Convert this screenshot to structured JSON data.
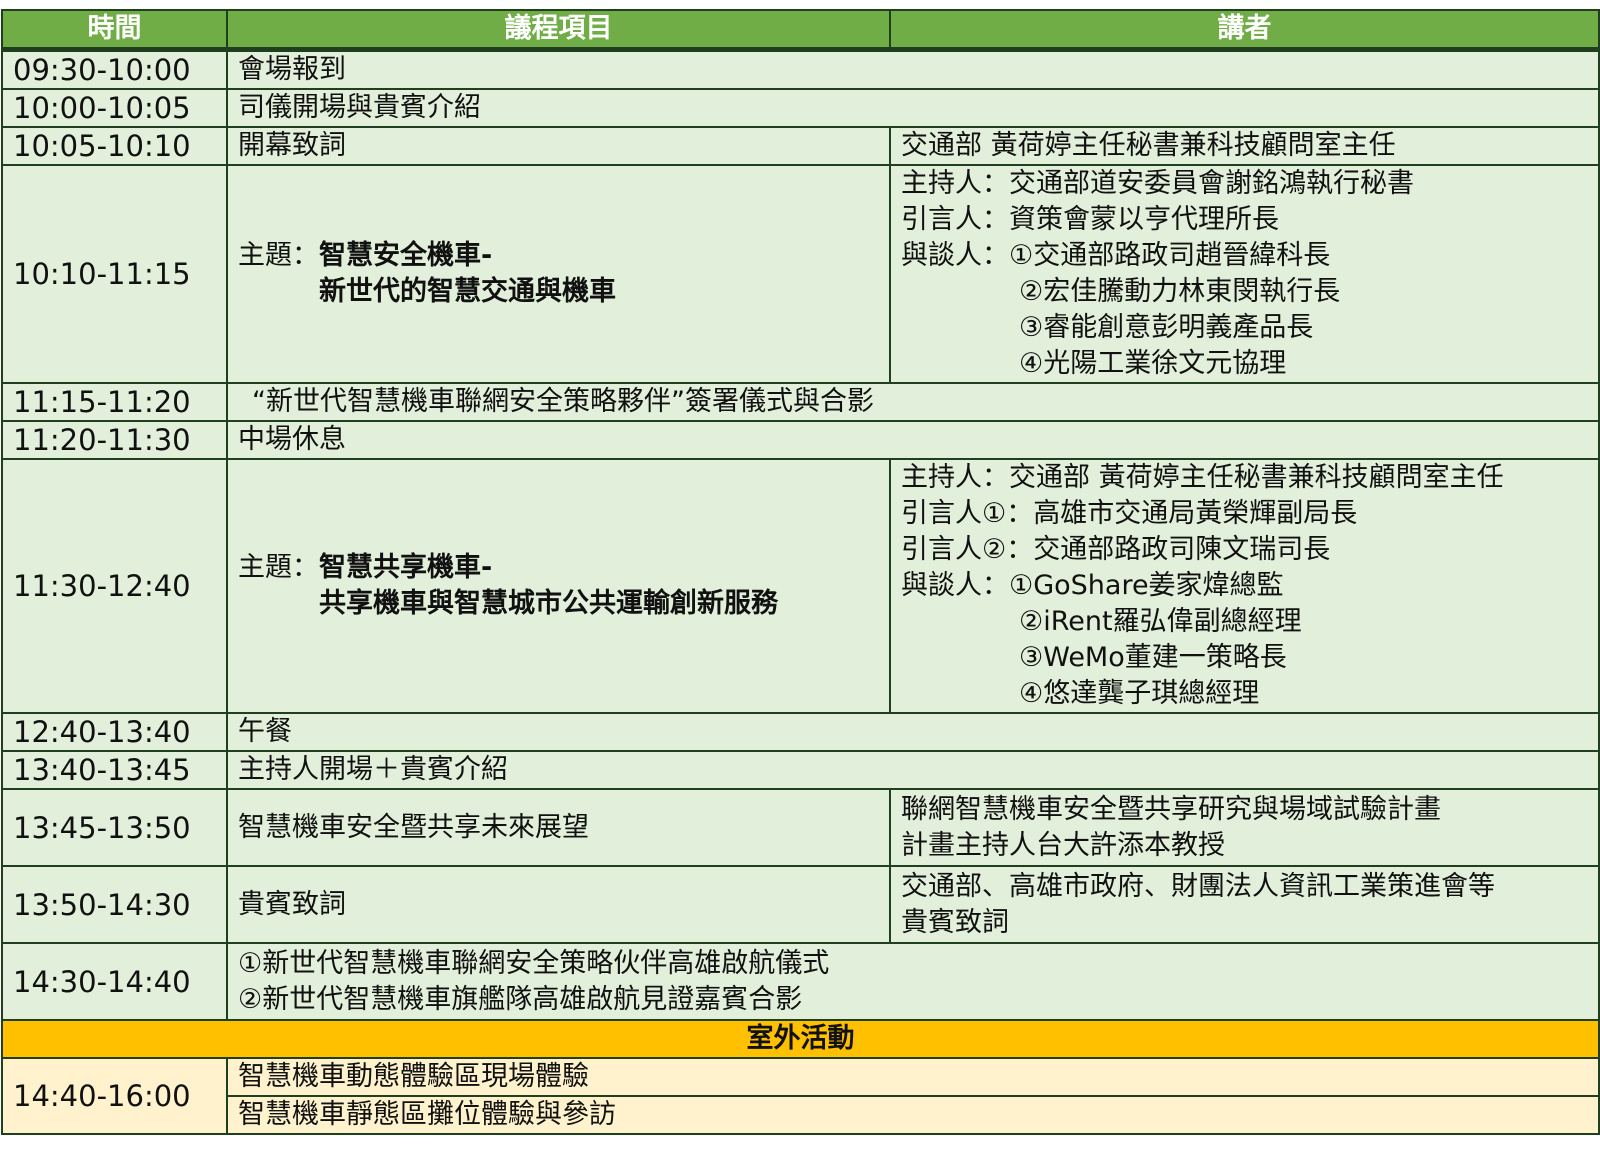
{
  "header": {
    "time": "時間",
    "item": "議程項目",
    "speaker": "講者"
  },
  "rows": [
    {
      "time": "09:30-10:00",
      "item": "會場報到"
    },
    {
      "time": "10:00-10:05",
      "item": "司儀開場與貴賓介紹"
    },
    {
      "time": "10:05-10:10",
      "item": "開幕致詞",
      "speaker": "交通部  黃荷婷主任秘書兼科技顧問室主任"
    },
    {
      "time": "10:10-11:15",
      "theme_label": "主題：",
      "theme_lines": [
        "智慧安全機車-",
        "新世代的智慧交通與機車"
      ],
      "speaker_lines": [
        "主持人：交通部道安委員會謝銘鴻執行秘書",
        "引言人：資策會蒙以亨代理所長",
        "與談人：①交通部路政司趙晉緯科長"
      ],
      "speaker_indent_lines": [
        "②宏佳騰動力林東閔執行長",
        "③睿能創意彭明義產品長",
        "④光陽工業徐文元協理"
      ]
    },
    {
      "time": "11:15-11:20",
      "item": "“新世代智慧機車聯網安全策略夥伴”簽署儀式與合影"
    },
    {
      "time": "11:20-11:30",
      "item": "中場休息"
    },
    {
      "time": "11:30-12:40",
      "theme_label": "主題：",
      "theme_lines": [
        "智慧共享機車-",
        "共享機車與智慧城市公共運輸創新服務"
      ],
      "speaker_lines": [
        "主持人：交通部  黃荷婷主任秘書兼科技顧問室主任",
        "引言人①：高雄市交通局黃榮輝副局長",
        "引言人②：交通部路政司陳文瑞司長",
        "與談人：①GoShare姜家煒總監"
      ],
      "speaker_indent_lines": [
        "②iRent羅弘偉副總經理",
        "③WeMo董建一策略長",
        "④悠達龔子琪總經理"
      ]
    },
    {
      "time": "12:40-13:40",
      "item": "午餐"
    },
    {
      "time": "13:40-13:45",
      "item": "主持人開場＋貴賓介紹"
    },
    {
      "time": "13:45-13:50",
      "item": "智慧機車安全暨共享未來展望",
      "speaker_lines": [
        "聯網智慧機車安全暨共享研究與場域試驗計畫",
        "計畫主持人台大許添本教授"
      ]
    },
    {
      "time": "13:50-14:30",
      "item": "貴賓致詞",
      "speaker_lines": [
        "交通部、高雄市政府、財團法人資訊工業策進會等",
        "貴賓致詞"
      ]
    },
    {
      "time": "14:30-14:40",
      "item_lines": [
        "①新世代智慧機車聯網安全策略伙伴高雄啟航儀式",
        "②新世代智慧機車旗艦隊高雄啟航見證嘉賓合影"
      ]
    }
  ],
  "outdoor": {
    "title": "室外活動",
    "time": "14:40-16:00",
    "items": [
      "智慧機車動態體驗區現場體驗",
      "智慧機車靜態區攤位體驗與參訪"
    ]
  },
  "colors": {
    "header_green": "#70ad47",
    "row_green": "#e2efda",
    "outdoor_orange": "#ffc000",
    "outdoor_cream": "#fff2cc",
    "border": "#1f3f1f"
  }
}
